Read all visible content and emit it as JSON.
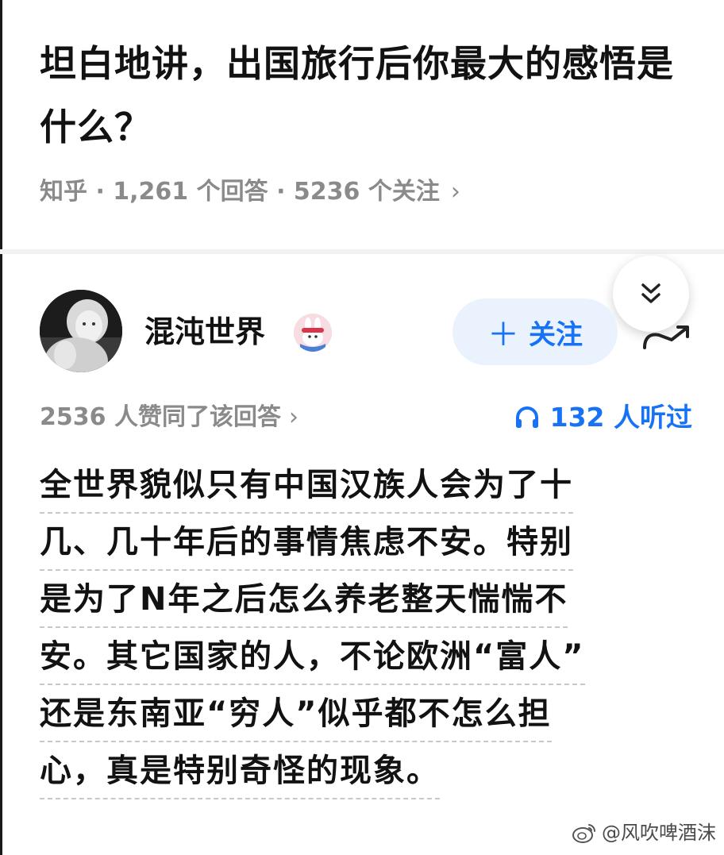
{
  "question": {
    "title": "坦白地讲，出国旅行后你最大的感悟是什么？",
    "meta": "知乎 · 1,261 个回答 · 5236 个关注",
    "meta_chevron": "›"
  },
  "author": {
    "name": "混沌世界",
    "follow_label": "关注",
    "follow_plus": "＋",
    "avatar_icon": "avatar-photo",
    "badge_icon": "rabbit-badge-icon"
  },
  "stats": {
    "likes_text": "2536 人赞同了该回答",
    "likes_chevron": "›",
    "listens_text": "132 人听过",
    "listens_icon": "headphones-icon"
  },
  "answer": {
    "lines": [
      "全世界貌似只有中国汉族人会为了十",
      "几、几十年后的事情焦虑不安。特别",
      "是为了N年之后怎么养老整天惴惴不",
      "安。其它国家的人，不论欧洲“富人”",
      "还是东南亚“穷人”似乎都不怎么担",
      "心，真是特别奇怪的现象。"
    ]
  },
  "watermark": {
    "text": "@风吹啤酒沫",
    "icon": "weibo-icon"
  },
  "colors": {
    "accent_blue": "#1772f6",
    "follow_bg": "#eaf2fd",
    "meta_gray": "#8a8a8a",
    "text_black": "#121212"
  }
}
